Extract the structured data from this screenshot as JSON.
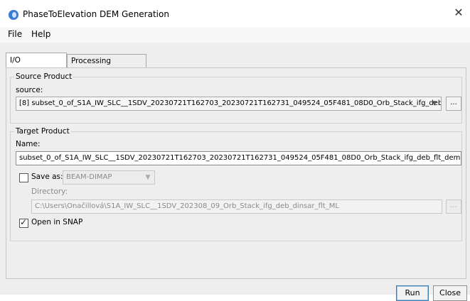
{
  "window": {
    "title": "PhaseToElevation DEM Generation"
  },
  "menu": {
    "items": [
      "File",
      "Help"
    ]
  },
  "tabs": [
    {
      "label": "I/O Parameters",
      "active": true
    },
    {
      "label": "Processing Parameters",
      "active": false
    }
  ],
  "source_product": {
    "group_title": "Source Product",
    "label": "source:",
    "value": "[8] subset_0_of_S1A_IW_SLC__1SDV_20230721T162703_20230721T162731_049524_05F481_08D0_Orb_Stack_ifg_deb...",
    "browse_label": "..."
  },
  "target_product": {
    "group_title": "Target Product",
    "name_label": "Name:",
    "name_value": "subset_0_of_S1A_IW_SLC__1SDV_20230721T162703_20230721T162731_049524_05F481_08D0_Orb_Stack_ifg_deb_flt_dem",
    "save_as_label": "Save as:",
    "save_as_checked": false,
    "format_value": "BEAM-DIMAP",
    "directory_label": "Directory:",
    "directory_value": "C:\\Users\\Onačillová\\S1A_IW_SLC__1SDV_202308_09_Orb_Stack_ifg_deb_dinsar_flt_ML",
    "browse_label": "...",
    "open_in_snap_label": "Open in SNAP",
    "open_in_snap_checked": true
  },
  "buttons": {
    "run": "Run",
    "close": "Close"
  },
  "icons": {
    "app": "snap-app-icon",
    "close": "close-icon",
    "dropdown": "chevron-down-icon"
  }
}
